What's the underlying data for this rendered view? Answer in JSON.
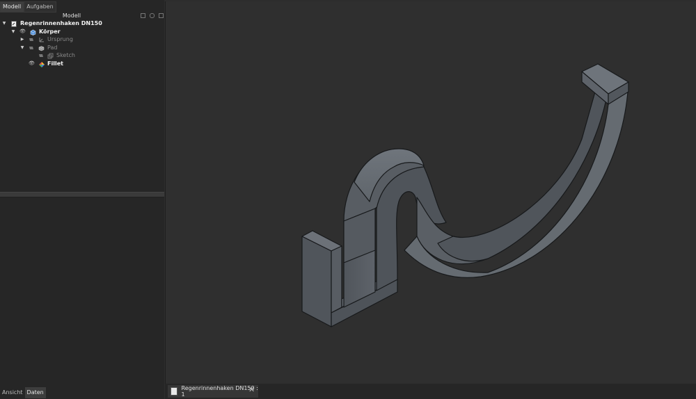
{
  "left_panel": {
    "tabs": [
      "Modell",
      "Aufgaben"
    ],
    "title": "Modell",
    "tree": [
      {
        "label": "Regenrinnenhaken DN150",
        "level": 0,
        "expanded": true,
        "bold": true
      },
      {
        "label": "Körper",
        "level": 1,
        "expanded": true,
        "bold": true
      },
      {
        "label": "Ursprung",
        "level": 2,
        "expanded": false,
        "dim": true
      },
      {
        "label": "Pad",
        "level": 2,
        "expanded": true,
        "dim": true
      },
      {
        "label": "Sketch",
        "level": 3,
        "dim": true
      },
      {
        "label": "Fillet",
        "level": 2,
        "bold": true
      }
    ],
    "bottom_tabs": [
      "Ansicht",
      "Daten"
    ]
  },
  "document_tab": {
    "label": "Regenrinnenhaken DN150 : 1",
    "close_icon": "close-icon"
  },
  "colors": {
    "panel_bg": "#262626",
    "viewport_bg": "#2f2f2f",
    "model_face": "#5a5f65",
    "model_edge": "#1a1c1e"
  }
}
